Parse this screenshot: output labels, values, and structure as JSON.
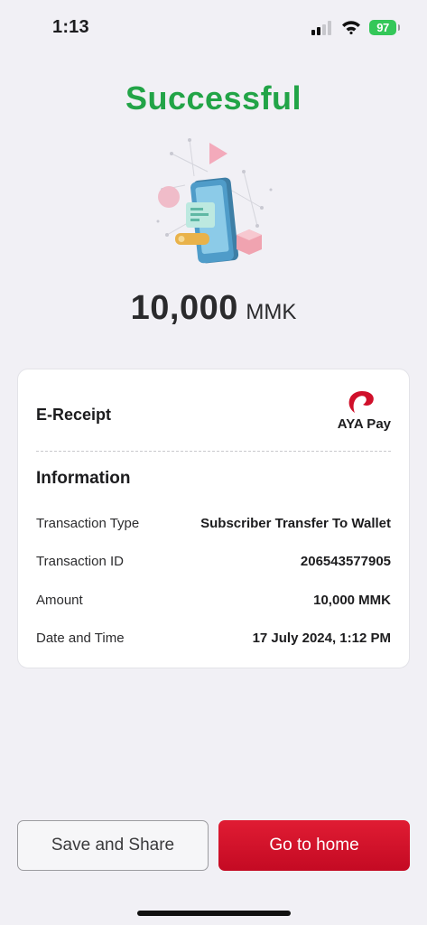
{
  "status_bar": {
    "time": "1:13",
    "battery": "97"
  },
  "title": "Successful",
  "amount": {
    "value": "10,000",
    "currency": "MMK"
  },
  "receipt": {
    "title": "E-Receipt",
    "brand": "AYA Pay",
    "section_heading": "Information",
    "rows": [
      {
        "label": "Transaction Type",
        "value": "Subscriber Transfer To Wallet"
      },
      {
        "label": "Transaction ID",
        "value": "206543577905"
      },
      {
        "label": "Amount",
        "value": "10,000 MMK"
      },
      {
        "label": "Date and Time",
        "value": "17 July 2024, 1:12 PM"
      }
    ]
  },
  "buttons": {
    "save_share": "Save and Share",
    "go_home": "Go to home"
  },
  "colors": {
    "success": "#22a447",
    "brand_red": "#d0102a",
    "background": "#f1f0f5"
  },
  "icons": [
    "signal-icon",
    "wifi-icon",
    "battery-icon",
    "ayapay-logo-icon",
    "phone-illustration"
  ]
}
